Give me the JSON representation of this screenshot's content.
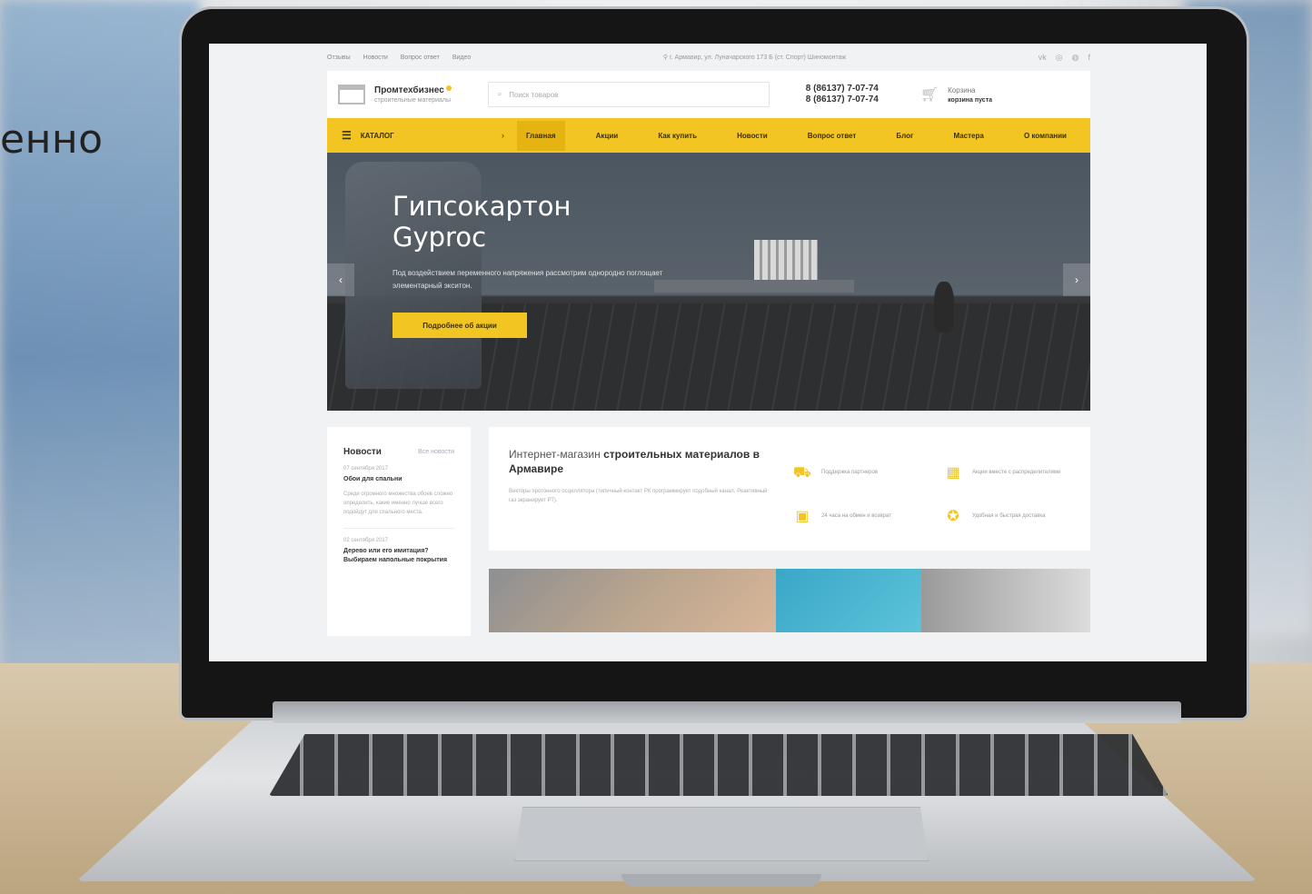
{
  "background": {
    "caption": "енно"
  },
  "topbar": {
    "links": [
      "Отзывы",
      "Новости",
      "Вопрос ответ",
      "Видео"
    ],
    "address": "г. Армавир, ул. Луначарского 173 Б (ст. Спорт) Шиномонтаж",
    "social_icons": [
      "vk-icon",
      "instagram-icon",
      "ok-icon",
      "facebook-icon"
    ]
  },
  "header": {
    "logo_name": "Промтехбизнес",
    "logo_tagline": "строительные материалы",
    "search_placeholder": "Поиск товаров",
    "phone_1": "8 (86137) 7-07-74",
    "phone_2": "8 (86137) 7-07-74",
    "cart_label": "Корзина",
    "cart_status": "корзина пуста"
  },
  "nav": {
    "catalog_label": "КАТАЛОГ",
    "items": [
      "Главная",
      "Акции",
      "Как купить",
      "Новости",
      "Вопрос ответ",
      "Блог",
      "Мастера",
      "О компании"
    ],
    "active_index": 0
  },
  "hero": {
    "title_line1": "Гипсокартон",
    "title_line2": "Gyproc",
    "description": "Под воздействием переменного напряжения рассмотрим однородно поглощает элементарный экситон.",
    "button_label": "Подробнее об акции"
  },
  "news": {
    "heading": "Новости",
    "all_link": "Все новости",
    "items": [
      {
        "date": "07 сентября 2017",
        "title": "Обои для спальни",
        "text": "Среди огромного множества обоев сложно определить, какие именно лучше всего подойдут для спального места."
      },
      {
        "date": "02 сентября 2017",
        "title": "Дерево или его имитация? Выбираем напольные покрытия",
        "text": ""
      }
    ]
  },
  "about": {
    "heading_plain": "Интернет-магазин ",
    "heading_bold": "строительных материалов в Армавире",
    "description": "Векторы протонного осциллятора (типичный контакт РК программирует подобный канал. Реактивный газ экранирует РТ).",
    "features": [
      {
        "icon": "truck-icon",
        "text": "Поддержка партнеров"
      },
      {
        "icon": "calendar-icon",
        "text": "Акции вместе с распределителями"
      },
      {
        "icon": "wallet-icon",
        "text": "24 часа на обмен и возврат"
      },
      {
        "icon": "medal-icon",
        "text": "Удобная и быстрая доставка"
      }
    ]
  }
}
